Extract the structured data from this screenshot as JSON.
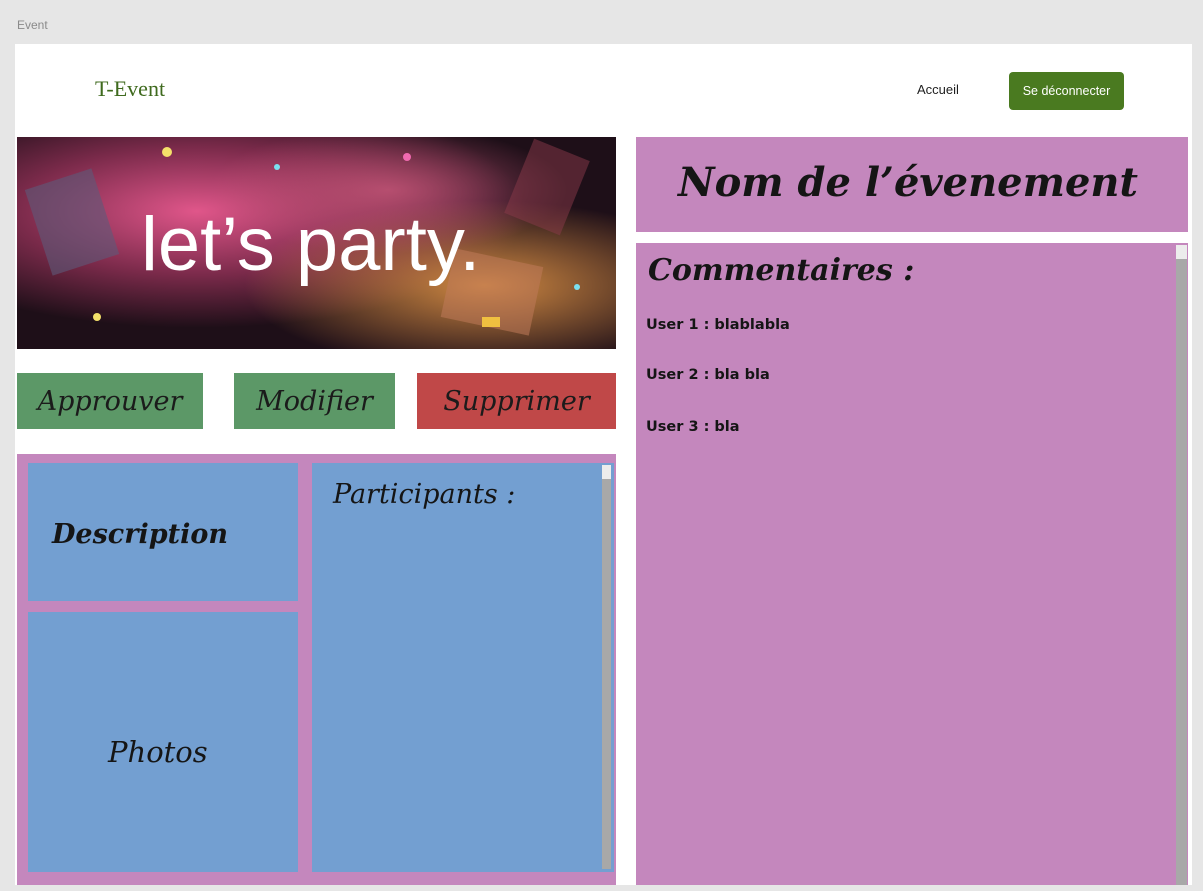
{
  "window": {
    "title": "Event"
  },
  "header": {
    "brand": "T-Event",
    "nav_home": "Accueil",
    "logout_label": "Se déconnecter"
  },
  "hero": {
    "banner_text": "let’s party."
  },
  "actions": {
    "approve_label": "Approuver",
    "edit_label": "Modifier",
    "delete_label": "Supprimer"
  },
  "panels": {
    "description_label": "Description",
    "photos_label": "Photos",
    "participants_label": "Participants :"
  },
  "event": {
    "name": "Nom de l’évenement"
  },
  "comments": {
    "title": "Commentaires :",
    "items": [
      {
        "text": "User 1 : blablabla"
      },
      {
        "text": "User 2 : bla bla"
      },
      {
        "text": "User 3 : bla"
      }
    ]
  },
  "colors": {
    "brand_green": "#3f6a1e",
    "logout_bg": "#4a7a20",
    "approve_bg": "#5c9867",
    "delete_bg": "#c04848",
    "panel_pink": "#c487bd",
    "panel_blue": "#739fd1"
  }
}
